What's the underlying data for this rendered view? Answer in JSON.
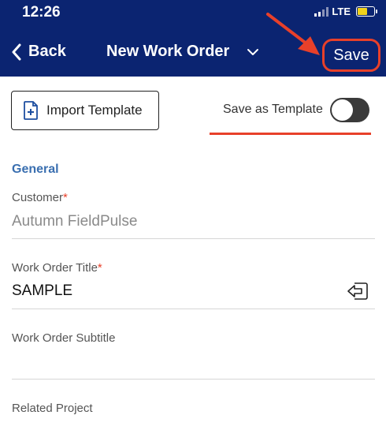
{
  "status_bar": {
    "time": "12:26",
    "network": "LTE"
  },
  "nav": {
    "back_label": "Back",
    "title": "New Work Order",
    "save_label": "Save"
  },
  "toolbar": {
    "import_label": "Import Template",
    "save_as_template_label": "Save as Template",
    "save_as_template_on": false
  },
  "form": {
    "section_title": "General",
    "customer": {
      "label": "Customer",
      "required_mark": "*",
      "value": "Autumn FieldPulse"
    },
    "title": {
      "label": "Work Order Title",
      "required_mark": "*",
      "value": "SAMPLE"
    },
    "subtitle": {
      "label": "Work Order Subtitle",
      "value": ""
    },
    "project": {
      "label": "Related Project"
    }
  },
  "colors": {
    "header_bg": "#0b2471",
    "accent_red": "#e8402a",
    "section_blue": "#3a6fb0"
  },
  "icons": [
    "chevron-left-icon",
    "chevron-down-icon",
    "document-plus-icon",
    "sign-in-icon",
    "signal-icon",
    "battery-icon"
  ]
}
